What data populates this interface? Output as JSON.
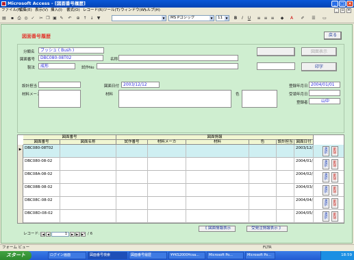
{
  "window": {
    "title": "Microsoft Access - [図面番号履歴]"
  },
  "menu": [
    "ファイル(F)",
    "編集(E)",
    "表示(V)",
    "挿入(I)",
    "書式(O)",
    "レコード(R)",
    "ツール(T)",
    "ウィンドウ(W)",
    "ヘルプ(H)"
  ],
  "toolbar": {
    "font_name": "MS Pゴシック",
    "font_size": "11"
  },
  "form": {
    "title": "図面番号履歴",
    "back_button": "戻る",
    "fields": {
      "bunrui_label": "分類名",
      "bunrui_value": "ブッシュ ( Bush )",
      "zumen_label": "図面番号",
      "zumen_value": "DBC080-08T02",
      "meisho_label": "名称",
      "meisho_value": "",
      "kouhou_label": "製法",
      "kouhou_value": "成形",
      "shiyou_label": "試作No",
      "shiyou_value": "",
      "sekkei_label": "設計担当",
      "sekkei_value": "",
      "zumenbi_label": "図面日付",
      "zumenbi_value": "2003/12/12",
      "zairyo_maker_label": "材料メーカ",
      "zairyo_label": "材料",
      "iro_label": "色",
      "touroku_label": "登録年月日",
      "touroku_value": "2004/01/01",
      "ukeire_label": "受領年月日",
      "tourokusha_label": "登録者",
      "tourokusha_value": "山中"
    },
    "buttons": {
      "zumen_hyouji": "図面表示",
      "print": "印字"
    }
  },
  "grid": {
    "group1": "図面番号",
    "group2": "図面情報",
    "headers": [
      "図面番号",
      "図面名称",
      "試作番号",
      "材料メーカ",
      "材料",
      "色",
      "設計担当",
      "図面日付"
    ],
    "rows": [
      {
        "zumen": "DBC080-08T02",
        "date": "2003/12/12",
        "current": true
      },
      {
        "zumen": "DBC080-08-02",
        "date": "2004/01/01",
        "current": false
      },
      {
        "zumen": "DBC08A-08-02",
        "date": "2004/02/02",
        "current": false
      },
      {
        "zumen": "DBC08B-08-02",
        "date": "2004/03/03",
        "current": false
      },
      {
        "zumen": "DBC08C-08-02",
        "date": "2004/04/04",
        "current": false
      },
      {
        "zumen": "DBC08D-08-02",
        "date": "2004/05/05",
        "current": false
      }
    ],
    "row_btn_select": "選択",
    "row_btn_delete": "削除"
  },
  "links": {
    "prev_info": "《 図面情報表示",
    "order_info": "受発注情報表示 》"
  },
  "nav": {
    "label": "レコード:",
    "current": "1",
    "total": "/ 6"
  },
  "status": {
    "left": "フォーム ビュー",
    "filter": "FLTR"
  },
  "taskbar": {
    "start": "スタート",
    "tasks": [
      "ログイン画面",
      "図面番号検索",
      "図面番号履歴",
      "¥¥KS2000¥csa...",
      "Microsoft Po...",
      "Microsoft Po..."
    ],
    "clock": "18:59"
  }
}
